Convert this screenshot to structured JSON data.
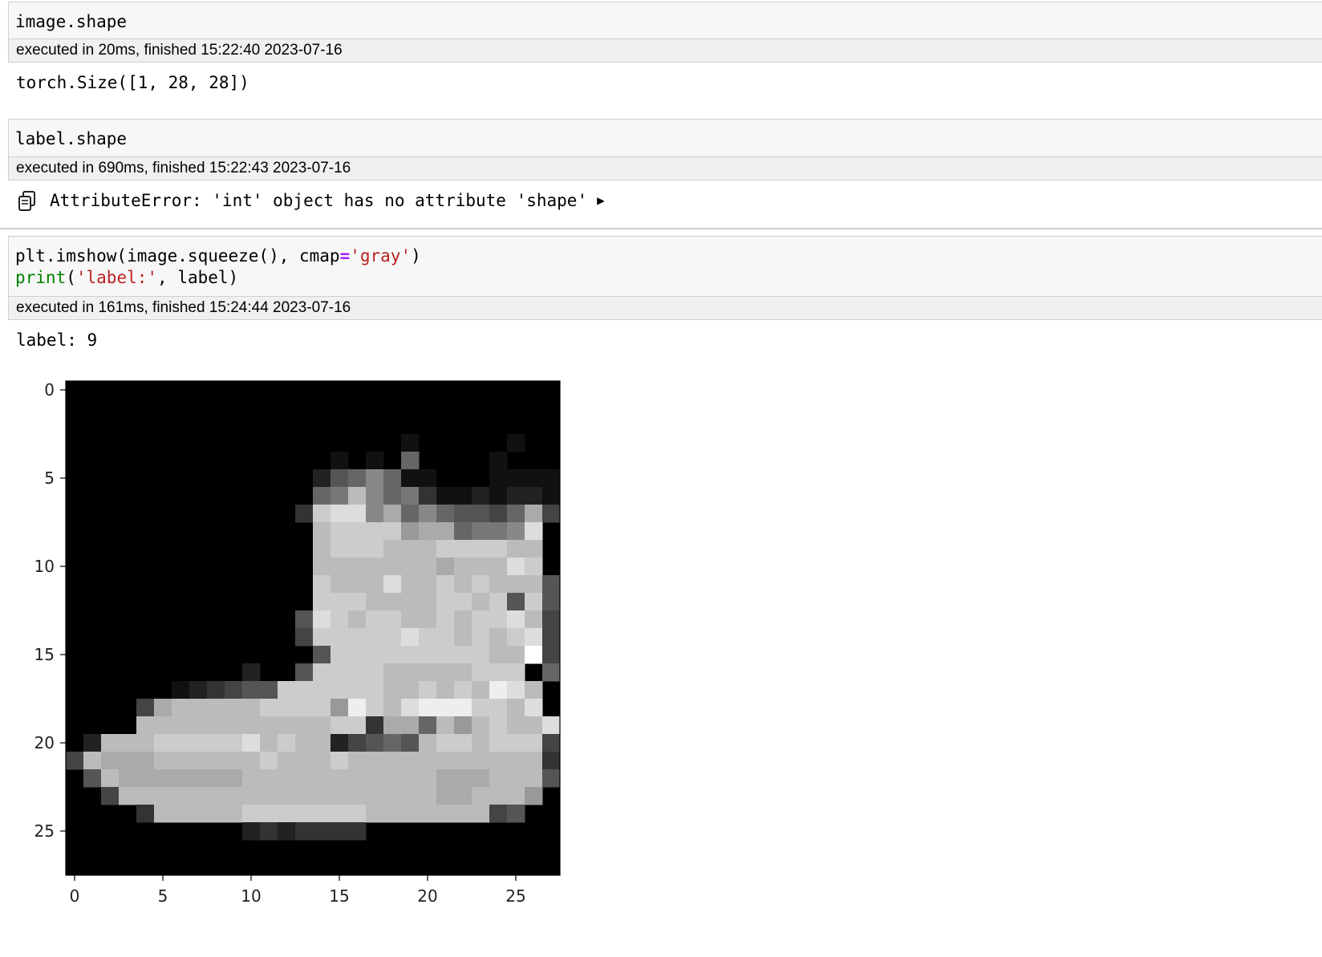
{
  "cells": [
    {
      "code": "image.shape",
      "exec": "executed in 20ms, finished 15:22:40 2023-07-16",
      "output": "torch.Size([1, 28, 28])"
    },
    {
      "code": "label.shape",
      "exec": "executed in 690ms, finished 15:22:43 2023-07-16",
      "error": "AttributeError: 'int' object has no attribute 'shape'"
    },
    {
      "code_line1_parts": [
        "plt.imshow(image.squeeze(), cmap",
        "=",
        "'gray'",
        ")"
      ],
      "code_line2_parts": [
        "print",
        "(",
        "'label:'",
        ", label)"
      ],
      "exec": "executed in 161ms, finished 15:24:44 2023-07-16",
      "output": "label: 9"
    }
  ],
  "icons": {
    "copy": "copy-icon",
    "expand": "expand-triangle-icon"
  },
  "chart_data": {
    "type": "heatmap",
    "colormap": "gray",
    "rows": 28,
    "cols": 28,
    "xticks": [
      0,
      5,
      10,
      15,
      20,
      25
    ],
    "yticks": [
      0,
      5,
      10,
      15,
      20,
      25
    ],
    "xlim": [
      -0.5,
      27.5
    ],
    "ylim": [
      27.5,
      -0.5
    ],
    "pixels": [
      "............................",
      "............................",
      "............................",
      "...................1.....1..",
      "...............1.1.6....1...",
      "..............2568611...1111",
      "..............67b86731121221",
      ".............3cdd8a6865546a4",
      "..............bcccc9aa6778d..",
      "..............bcccbbbccccbb.",
      "..............bbbbbbbabbbdc.",
      "..............cbbbdbbcbcbbb5",
      "..............cccbbbbccbc5c5",
      ".............5dcbccbbcbccdb4",
      ".............4cccccdccbcbcd4",
      "..............5cccccccccbbf4",
      "..........2..5ccccbbbbbccc.6",
      "......123455ccccccbbcbcbedb.",
      "....4abbbbbcccc9ecbdeeeccbd.",
      "....bbbbbbbbbbbcc3aa6b9bcbbd",
      ".2bbbcccccdbcbb24565bccbccc4",
      "4baaabbbbbbcbbbcbbbbbbbbbbb3",
      ".5baaaaaaabbbbbbbbbbbaaabbb5",
      "..4bbbbbbbbbbbbbbbbbbaabbb9.",
      "....3bbbbbcccccccbbbbbbb45..",
      "..........2323333...........",
      "............................",
      "............................"
    ]
  }
}
